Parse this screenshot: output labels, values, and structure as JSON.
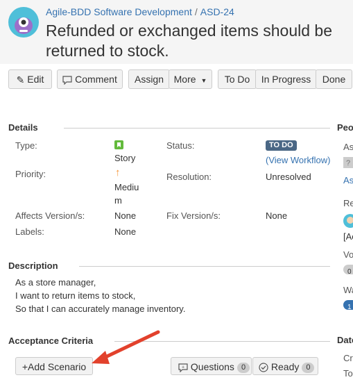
{
  "header": {
    "project": "Agile-BDD Software Development",
    "separator": "/",
    "issue_key": "ASD-24",
    "title": "Refunded or exchanged items should be returned to stock."
  },
  "toolbar": {
    "edit": "Edit",
    "comment": "Comment",
    "assign": "Assign",
    "more": "More",
    "todo": "To Do",
    "in_progress": "In Progress",
    "done": "Done"
  },
  "details": {
    "heading": "Details",
    "type_label": "Type:",
    "type_value": "Story",
    "status_label": "Status:",
    "status_value": "TO DO",
    "view_workflow": "(View Workflow)",
    "priority_label": "Priority:",
    "priority_value_line1": "Mediu",
    "priority_value_line2": "m",
    "resolution_label": "Resolution:",
    "resolution_value": "Unresolved",
    "affects_label": "Affects Version/s:",
    "affects_value": "None",
    "fix_label": "Fix Version/s:",
    "fix_value": "None",
    "labels_label": "Labels:",
    "labels_value": "None"
  },
  "description": {
    "heading": "Description",
    "line1": "As a store manager,",
    "line2": "I want to return items to stock,",
    "line3": "So that I can accurately manage inventory."
  },
  "acceptance": {
    "heading": "Acceptance Criteria",
    "add_scenario": "+Add Scenario",
    "questions": "Questions",
    "questions_count": "0",
    "ready": "Ready",
    "ready_count": "0"
  },
  "sidebar": {
    "people_heading": "Peo",
    "assignee_fragment": "As",
    "assign_link_fragment": "As",
    "reporter_fragment": "Re",
    "reporter_name_fragment": "[Ac",
    "votes_fragment": "Vo",
    "votes_count": "0",
    "watchers_fragment": "Wa",
    "watchers_count": "1",
    "dates_heading": "Date",
    "created_fragment": "Cr",
    "updated_fragment": "To"
  },
  "colors": {
    "link": "#3572b0",
    "status_lozenge": "#4a6785",
    "story_icon": "#63ba3c",
    "priority_icon": "#f79232",
    "arrow": "#e2412c"
  }
}
